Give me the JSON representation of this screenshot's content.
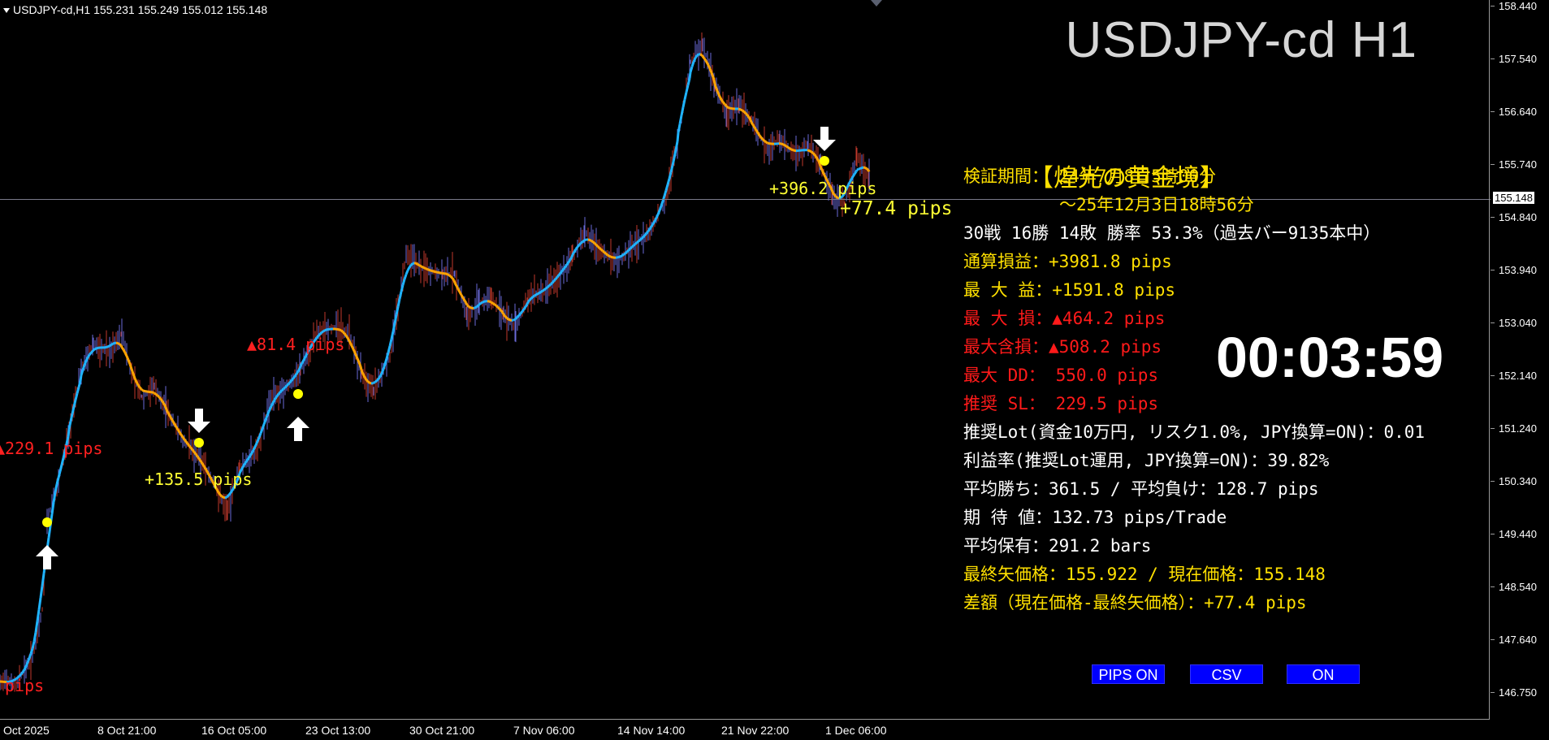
{
  "window": {
    "symbol_header": "USDJPY-cd,H1  155.231 155.249 155.012 155.148",
    "big_title": "USDJPY-cd H1"
  },
  "price_axis": {
    "ticks": [
      "158.440",
      "157.540",
      "156.640",
      "155.740",
      "154.840",
      "153.940",
      "153.040",
      "152.140",
      "151.240",
      "150.340",
      "149.440",
      "148.540",
      "147.640",
      "146.750"
    ],
    "current_price": "155.148"
  },
  "time_axis": {
    "ticks": [
      "Oct 2025",
      "8 Oct 21:00",
      "16 Oct 05:00",
      "23 Oct 13:00",
      "30 Oct 21:00",
      "7 Nov 06:00",
      "14 Nov 14:00",
      "21 Nov 22:00",
      "1 Dec 06:00"
    ]
  },
  "chart_labels": {
    "loss_229": "▲229.1 pips",
    "pips_bottom": "pips",
    "profit_135": "+135.5 pips",
    "loss_81": "▲81.4 pips",
    "profit_396": "+396.2 pips",
    "profit_77": "+77.4 pips"
  },
  "panel": {
    "title": "【煌光の黄金境】",
    "period_label": "検証期間： 24年7月8日5時00分",
    "period_end": "～25年12月3日18時56分",
    "record": "30戦 16勝 14敗 勝率 53.3%（過去バー9135本中）",
    "total_pl": "通算損益：+3981.8 pips",
    "max_profit": "最 大 益：+1591.8 pips",
    "max_loss": "最 大 損：▲464.2 pips",
    "max_unrealized": "最大含損：▲508.2 pips",
    "max_dd": "最大  DD： 550.0 pips",
    "recommended_sl": "推奨  SL： 229.5 pips",
    "recommended_lot": "推奨Lot(資金10万円, リスク1.0%, JPY換算=ON)：0.01",
    "profit_rate": "利益率(推奨Lot運用, JPY換算=ON)：39.82%",
    "avg_win_loss": "平均勝ち：361.5 / 平均負け：128.7 pips",
    "expectancy": "期 待 値：132.73 pips/Trade",
    "avg_hold": "平均保有：291.2 bars",
    "last_arrow_price": "最終矢価格：155.922 / 現在価格：155.148",
    "difference": "差額（現在価格-最終矢価格）：+77.4 pips"
  },
  "timer": "00:03:59",
  "buttons": {
    "pips": "PIPS ON",
    "csv": "CSV",
    "on": "ON"
  },
  "colors": {
    "background": "#000000",
    "ma_up": "#1fb4ff",
    "ma_down": "#ffa500",
    "signal_dot": "#ffff00",
    "panel_yellow": "#ffe000",
    "panel_red": "#ff1a1a",
    "button_blue": "#0000ff"
  },
  "chart_data": {
    "type": "line",
    "title": "USDJPY-cd H1",
    "y_range": [
      146.75,
      158.44
    ],
    "series": [
      {
        "x": [
          "Oct 2025",
          "8 Oct 21:00",
          "16 Oct 05:00",
          "23 Oct 13:00",
          "30 Oct 21:00",
          "7 Nov 06:00",
          "14 Nov 14:00",
          "21 Nov 22:00",
          "1 Dec 06:00"
        ],
        "values": [
          147.0,
          152.7,
          150.6,
          152.1,
          153.8,
          154.6,
          157.8,
          156.3,
          155.15
        ]
      }
    ],
    "signals": [
      {
        "type": "buy",
        "label": "▲229.1 pips"
      },
      {
        "type": "sell",
        "label": "+135.5 pips"
      },
      {
        "type": "buy",
        "label": "▲81.4 pips"
      },
      {
        "type": "sell",
        "label": "+396.2 pips"
      }
    ]
  }
}
